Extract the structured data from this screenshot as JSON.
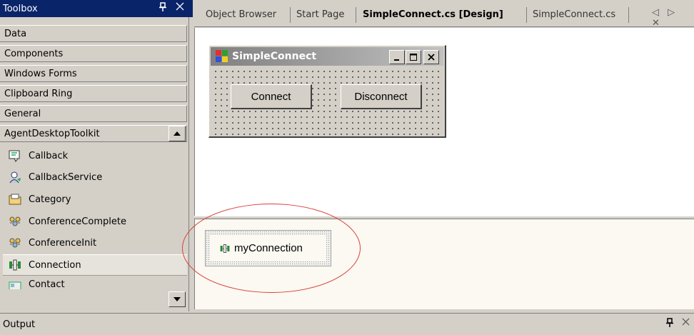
{
  "toolbox": {
    "title": "Toolbox",
    "pin_glyph": "ħ",
    "close_glyph": "✕",
    "categories": [
      "Data",
      "Components",
      "Windows Forms",
      "Clipboard Ring",
      "General",
      "AgentDesktopToolkit"
    ],
    "items": [
      {
        "label": "Callback",
        "icon": "callback-icon"
      },
      {
        "label": "CallbackService",
        "icon": "callback-service-icon"
      },
      {
        "label": "Category",
        "icon": "category-icon"
      },
      {
        "label": "ConferenceComplete",
        "icon": "conference-complete-icon"
      },
      {
        "label": "ConferenceInit",
        "icon": "conference-init-icon"
      },
      {
        "label": "Connection",
        "icon": "connection-icon",
        "selected": true
      },
      {
        "label": "Contact",
        "icon": "contact-icon"
      }
    ]
  },
  "tabs": [
    {
      "label": "Object Browser"
    },
    {
      "label": "Start Page"
    },
    {
      "label": "SimpleConnect.cs [Design]",
      "active": true
    },
    {
      "label": "SimpleConnect.cs"
    }
  ],
  "tab_nav": "◁ ▷ ✕",
  "form": {
    "title": "SimpleConnect",
    "buttons": {
      "connect": "Connect",
      "disconnect": "Disconnect"
    }
  },
  "tray": {
    "component_label": "myConnection"
  },
  "output": {
    "title": "Output"
  },
  "colors": {
    "titlebar_active": "#0a246a",
    "chrome": "#d4d0c8",
    "highlight_ring": "#d9403a"
  }
}
